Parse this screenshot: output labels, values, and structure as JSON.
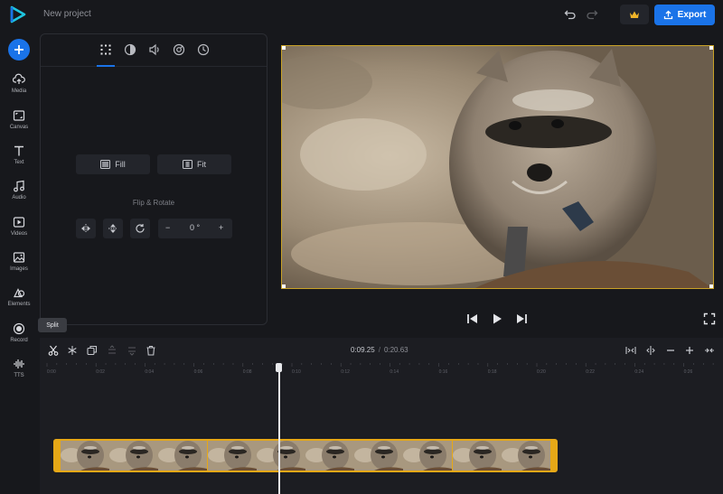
{
  "header": {
    "project_name": "New project",
    "export_label": "Export"
  },
  "sidebar": {
    "items": [
      {
        "label": "Media",
        "icon": "cloud-upload-icon"
      },
      {
        "label": "Canvas",
        "icon": "canvas-icon"
      },
      {
        "label": "Text",
        "icon": "text-icon"
      },
      {
        "label": "Audio",
        "icon": "music-note-icon"
      },
      {
        "label": "Videos",
        "icon": "video-icon"
      },
      {
        "label": "Images",
        "icon": "image-icon"
      },
      {
        "label": "Elements",
        "icon": "elements-icon"
      },
      {
        "label": "Record",
        "icon": "record-icon"
      },
      {
        "label": "TTS",
        "icon": "waveform-icon"
      }
    ]
  },
  "panel": {
    "fill_label": "Fill",
    "fit_label": "Fit",
    "flip_rotate_title": "Flip & Rotate",
    "rotation_value": "0 °"
  },
  "timeline": {
    "split_tooltip": "Split",
    "current_time": "0:09.25",
    "separator": "/",
    "total_time": "0:20.63",
    "ruler_ticks": [
      "0:00",
      "0:02",
      "0:04",
      "0:06",
      "0:08",
      "0:10",
      "0:12",
      "0:14",
      "0:16",
      "0:18",
      "0:20",
      "0:22",
      "0:24",
      "0:26"
    ]
  },
  "colors": {
    "accent": "#1a73e8",
    "clip_border": "#e6a817",
    "background": "#17181c"
  }
}
